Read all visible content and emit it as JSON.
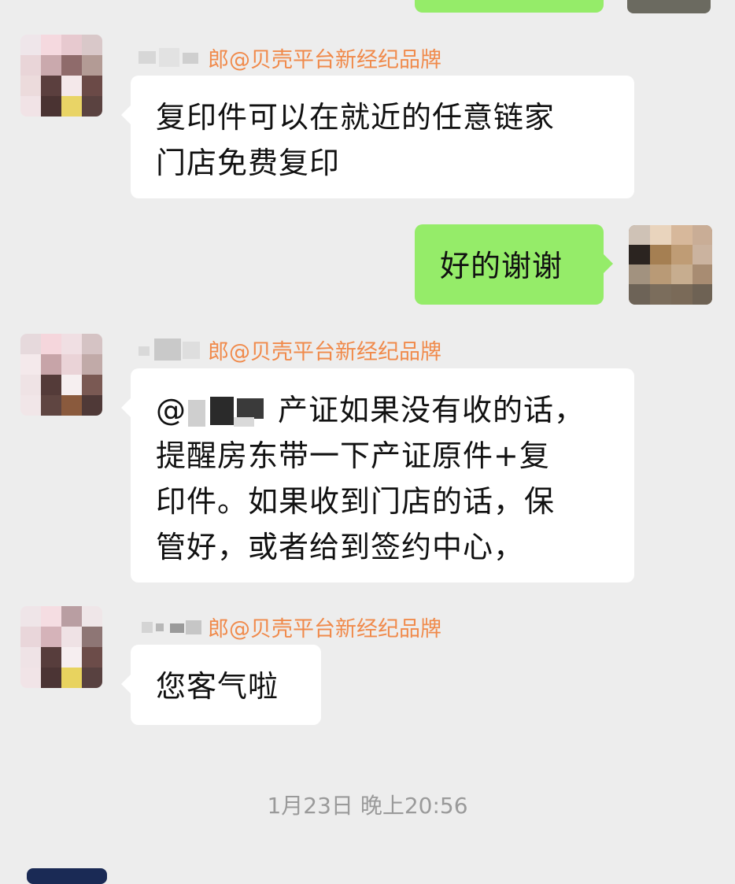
{
  "window": {
    "background": "#ededed",
    "bubble_incoming": "#ffffff",
    "bubble_outgoing": "#95ec69",
    "sender_color": "#f08a4b",
    "timestamp_color": "#9a9a9a"
  },
  "messages": [
    {
      "direction": "incoming",
      "sender_suffix": "郎@贝壳平台新经纪品牌",
      "lines": [
        "复印件可以在就近的任意链家",
        "门店免费复印"
      ]
    },
    {
      "direction": "outgoing",
      "lines": [
        "好的谢谢"
      ]
    },
    {
      "direction": "incoming",
      "sender_suffix": "郎@贝壳平台新经纪品牌",
      "mention_prefix": "@",
      "lines": [
        "产证如果没有收的话，",
        "提醒房东带一下产证原件+复",
        "印件。如果收到门店的话，保",
        "管好，或者给到签约中心，"
      ]
    },
    {
      "direction": "incoming",
      "sender_suffix": "郎@贝壳平台新经纪品牌",
      "lines": [
        "您客气啦"
      ]
    }
  ],
  "timestamp": "1月23日 晚上20:56",
  "icons": {
    "avatar_blurred": "pixelated-avatar-icon",
    "name_mask": "redacted-name-icon"
  }
}
